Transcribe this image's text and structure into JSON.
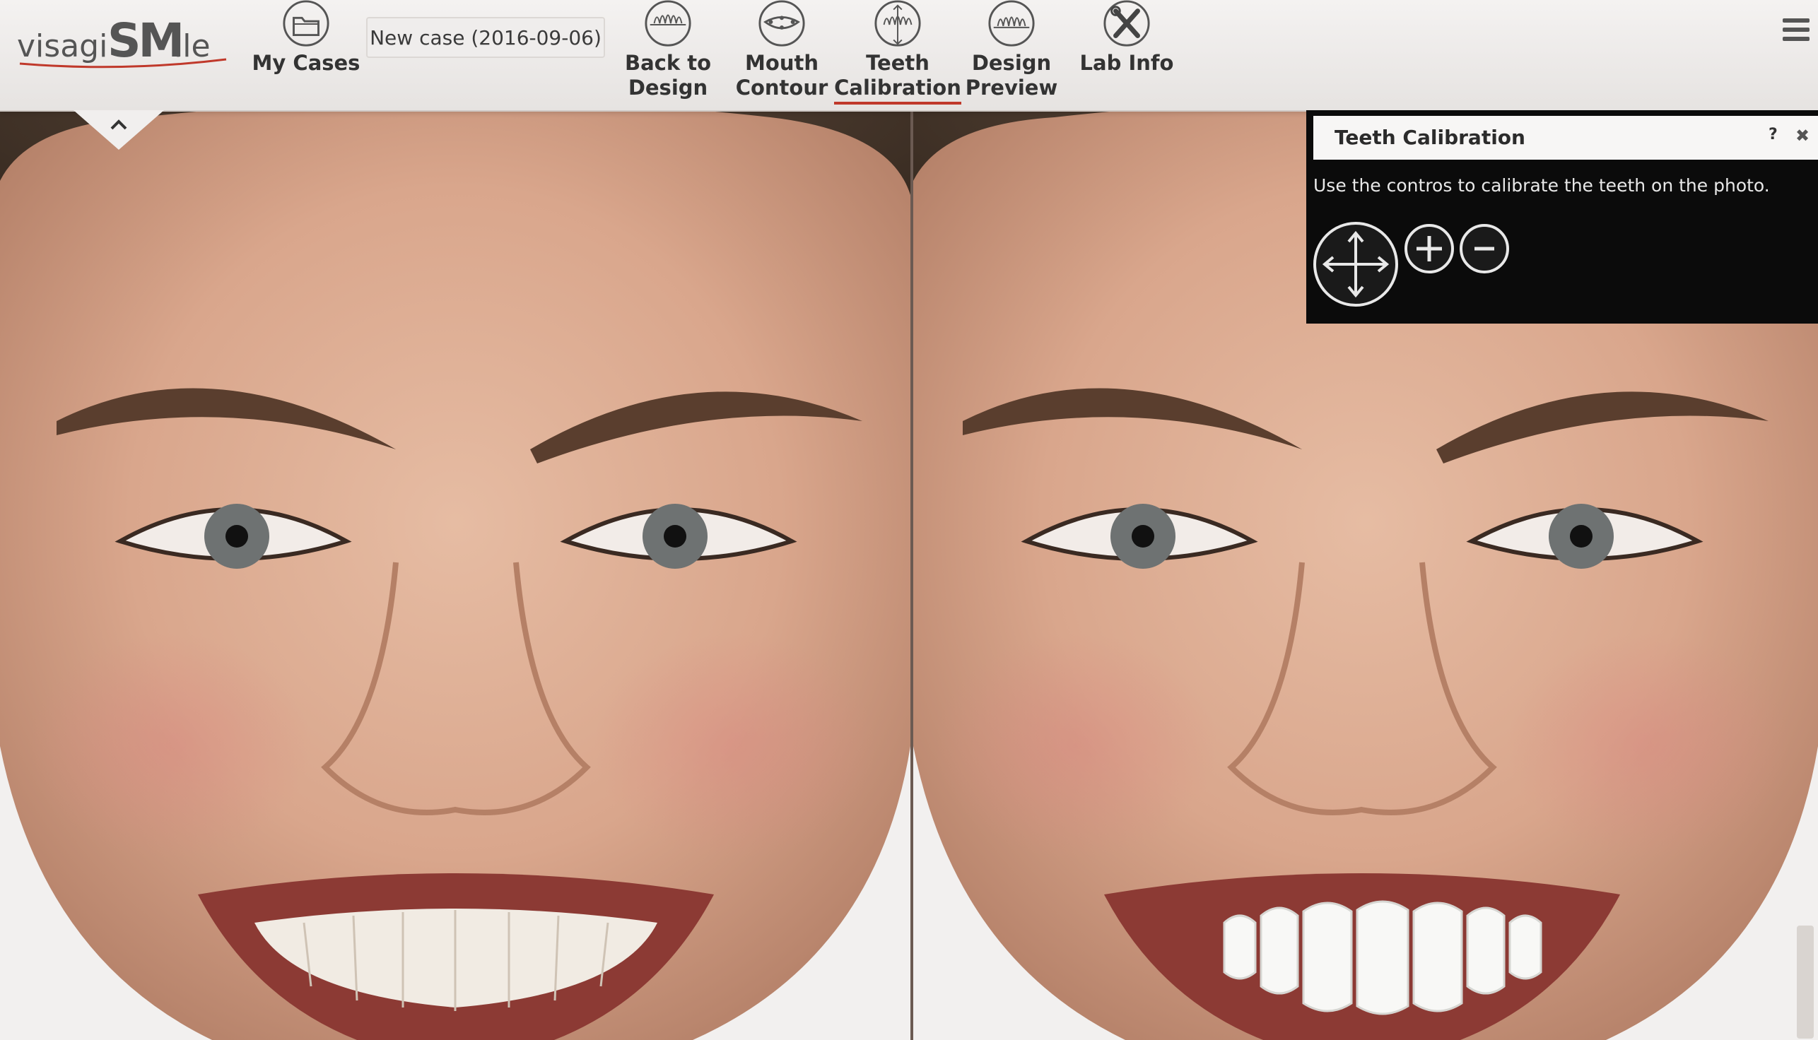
{
  "app": {
    "logo_text": "visagiSMile",
    "case_name": "New case (2016-09-06)"
  },
  "toolbar": {
    "my_cases": "My Cases",
    "back_to_design_1": "Back to",
    "back_to_design_2": "Design",
    "mouth_contour_1": "Mouth",
    "mouth_contour_2": "Contour",
    "teeth_calibration_1": "Teeth",
    "teeth_calibration_2": "Calibration",
    "design_preview_1": "Design",
    "design_preview_2": "Preview",
    "lab_info": "Lab Info",
    "active_tool": "Teeth Calibration"
  },
  "calibration_panel": {
    "title": "Teeth Calibration",
    "help": "?",
    "close": "✖",
    "instructions": "Use the contros to calibrate the teeth on the photo.",
    "controls": [
      "move-icon",
      "zoom-in-icon",
      "zoom-out-icon"
    ]
  },
  "colors": {
    "accent": "#c0392b",
    "panel_bg": "#0b0b0b",
    "toolbar_bg": "#eceae8"
  }
}
